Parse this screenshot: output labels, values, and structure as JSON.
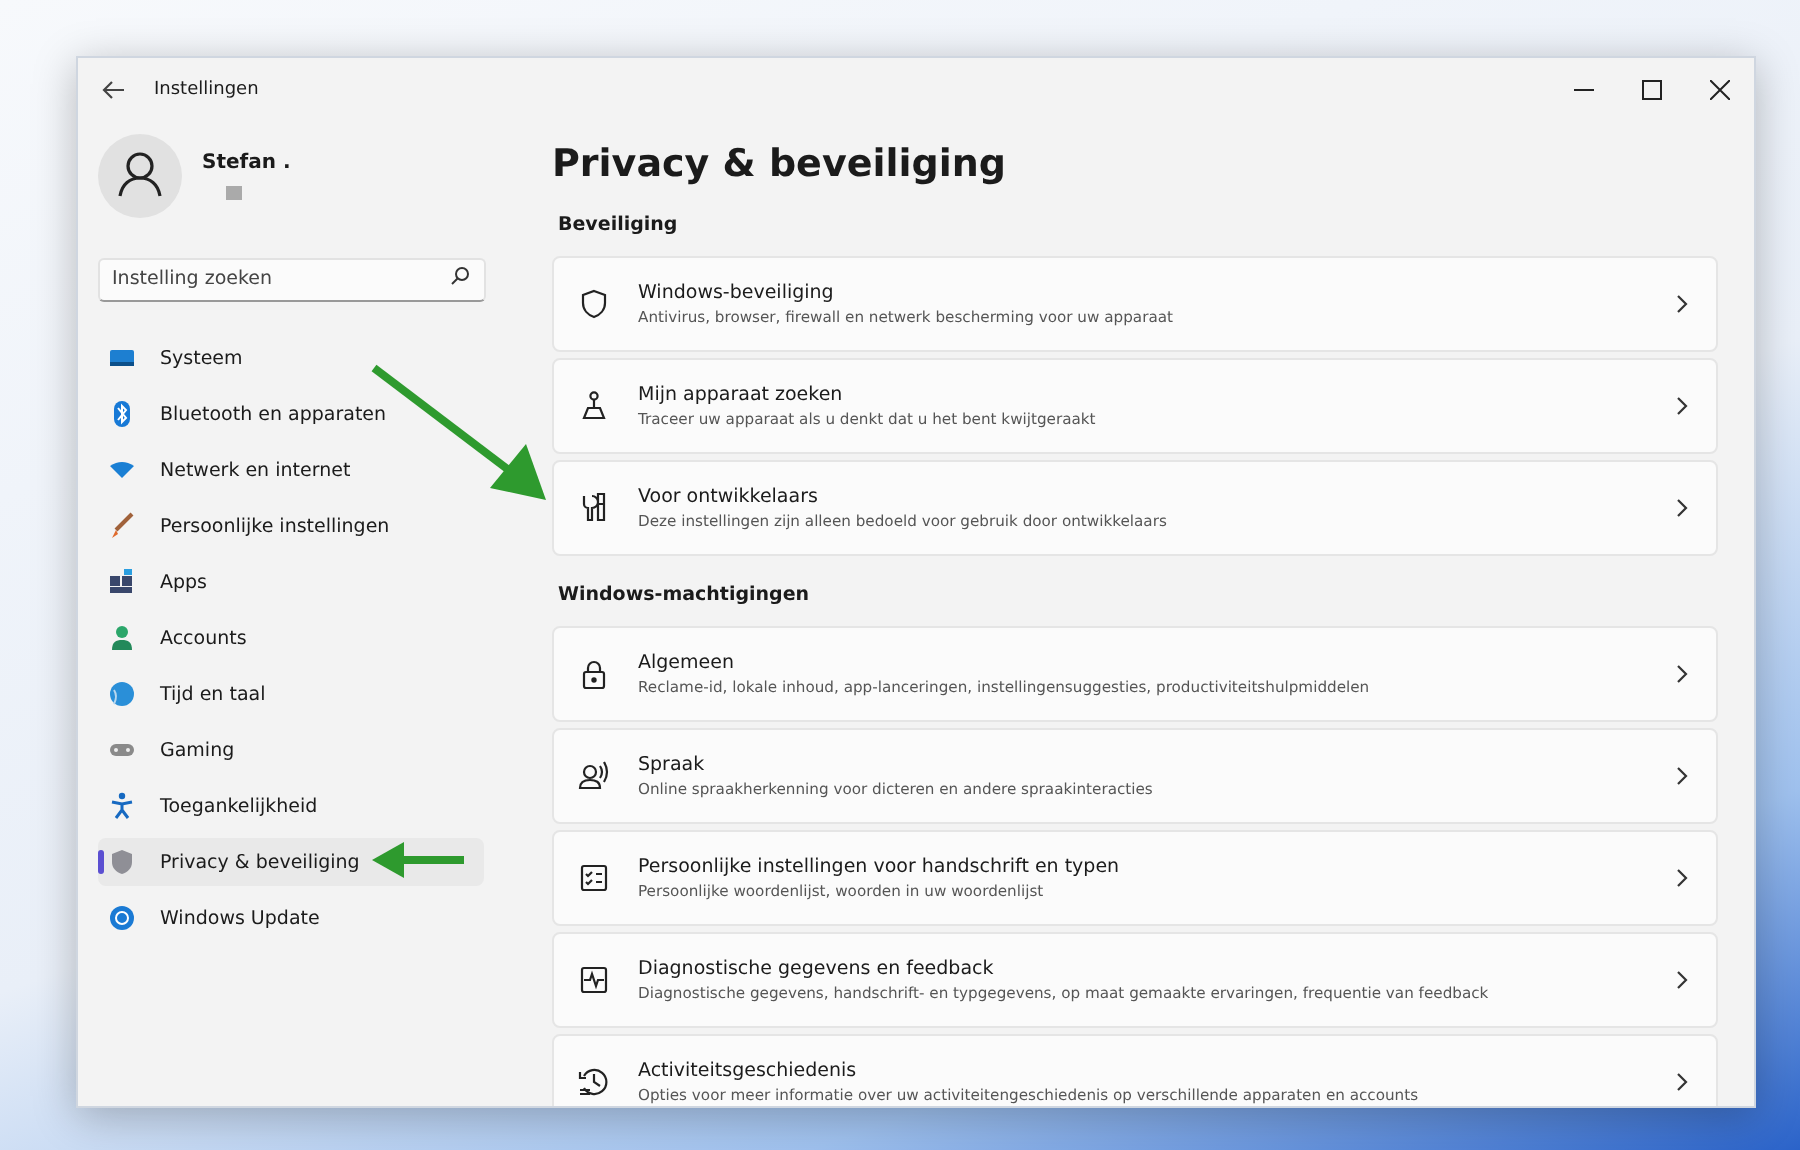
{
  "window": {
    "title": "Instellingen"
  },
  "user": {
    "name": "Stefan ."
  },
  "search": {
    "placeholder": "Instelling zoeken"
  },
  "nav": [
    {
      "label": "Systeem",
      "selected": false
    },
    {
      "label": "Bluetooth en apparaten",
      "selected": false
    },
    {
      "label": "Netwerk en internet",
      "selected": false
    },
    {
      "label": "Persoonlijke instellingen",
      "selected": false
    },
    {
      "label": "Apps",
      "selected": false
    },
    {
      "label": "Accounts",
      "selected": false
    },
    {
      "label": "Tijd en taal",
      "selected": false
    },
    {
      "label": "Gaming",
      "selected": false
    },
    {
      "label": "Toegankelijkheid",
      "selected": false
    },
    {
      "label": "Privacy & beveiliging",
      "selected": true
    },
    {
      "label": "Windows Update",
      "selected": false
    }
  ],
  "page_title": "Privacy & beveiliging",
  "sections": [
    {
      "heading": "Beveiliging",
      "items": [
        {
          "title": "Windows-beveiliging",
          "description": "Antivirus, browser, firewall en netwerk bescherming voor uw apparaat"
        },
        {
          "title": "Mijn apparaat zoeken",
          "description": "Traceer uw apparaat als u denkt dat u het bent kwijtgeraakt"
        },
        {
          "title": "Voor ontwikkelaars",
          "description": "Deze instellingen zijn alleen bedoeld voor gebruik door ontwikkelaars"
        }
      ]
    },
    {
      "heading": "Windows-machtigingen",
      "items": [
        {
          "title": "Algemeen",
          "description": "Reclame-id, lokale inhoud, app-lanceringen, instellingensuggesties, productiviteitshulpmiddelen"
        },
        {
          "title": "Spraak",
          "description": "Online spraakherkenning voor dicteren en andere spraakinteracties"
        },
        {
          "title": "Persoonlijke instellingen voor handschrift en typen",
          "description": "Persoonlijke woordenlijst, woorden in uw woordenlijst"
        },
        {
          "title": "Diagnostische gegevens en feedback",
          "description": "Diagnostische gegevens, handschrift- en typgegevens, op maat gemaakte ervaringen, frequentie van feedback"
        },
        {
          "title": "Activiteitsgeschiedenis",
          "description": "Opties voor meer informatie over uw activiteitengeschiedenis op verschillende apparaten en accounts"
        }
      ]
    }
  ]
}
